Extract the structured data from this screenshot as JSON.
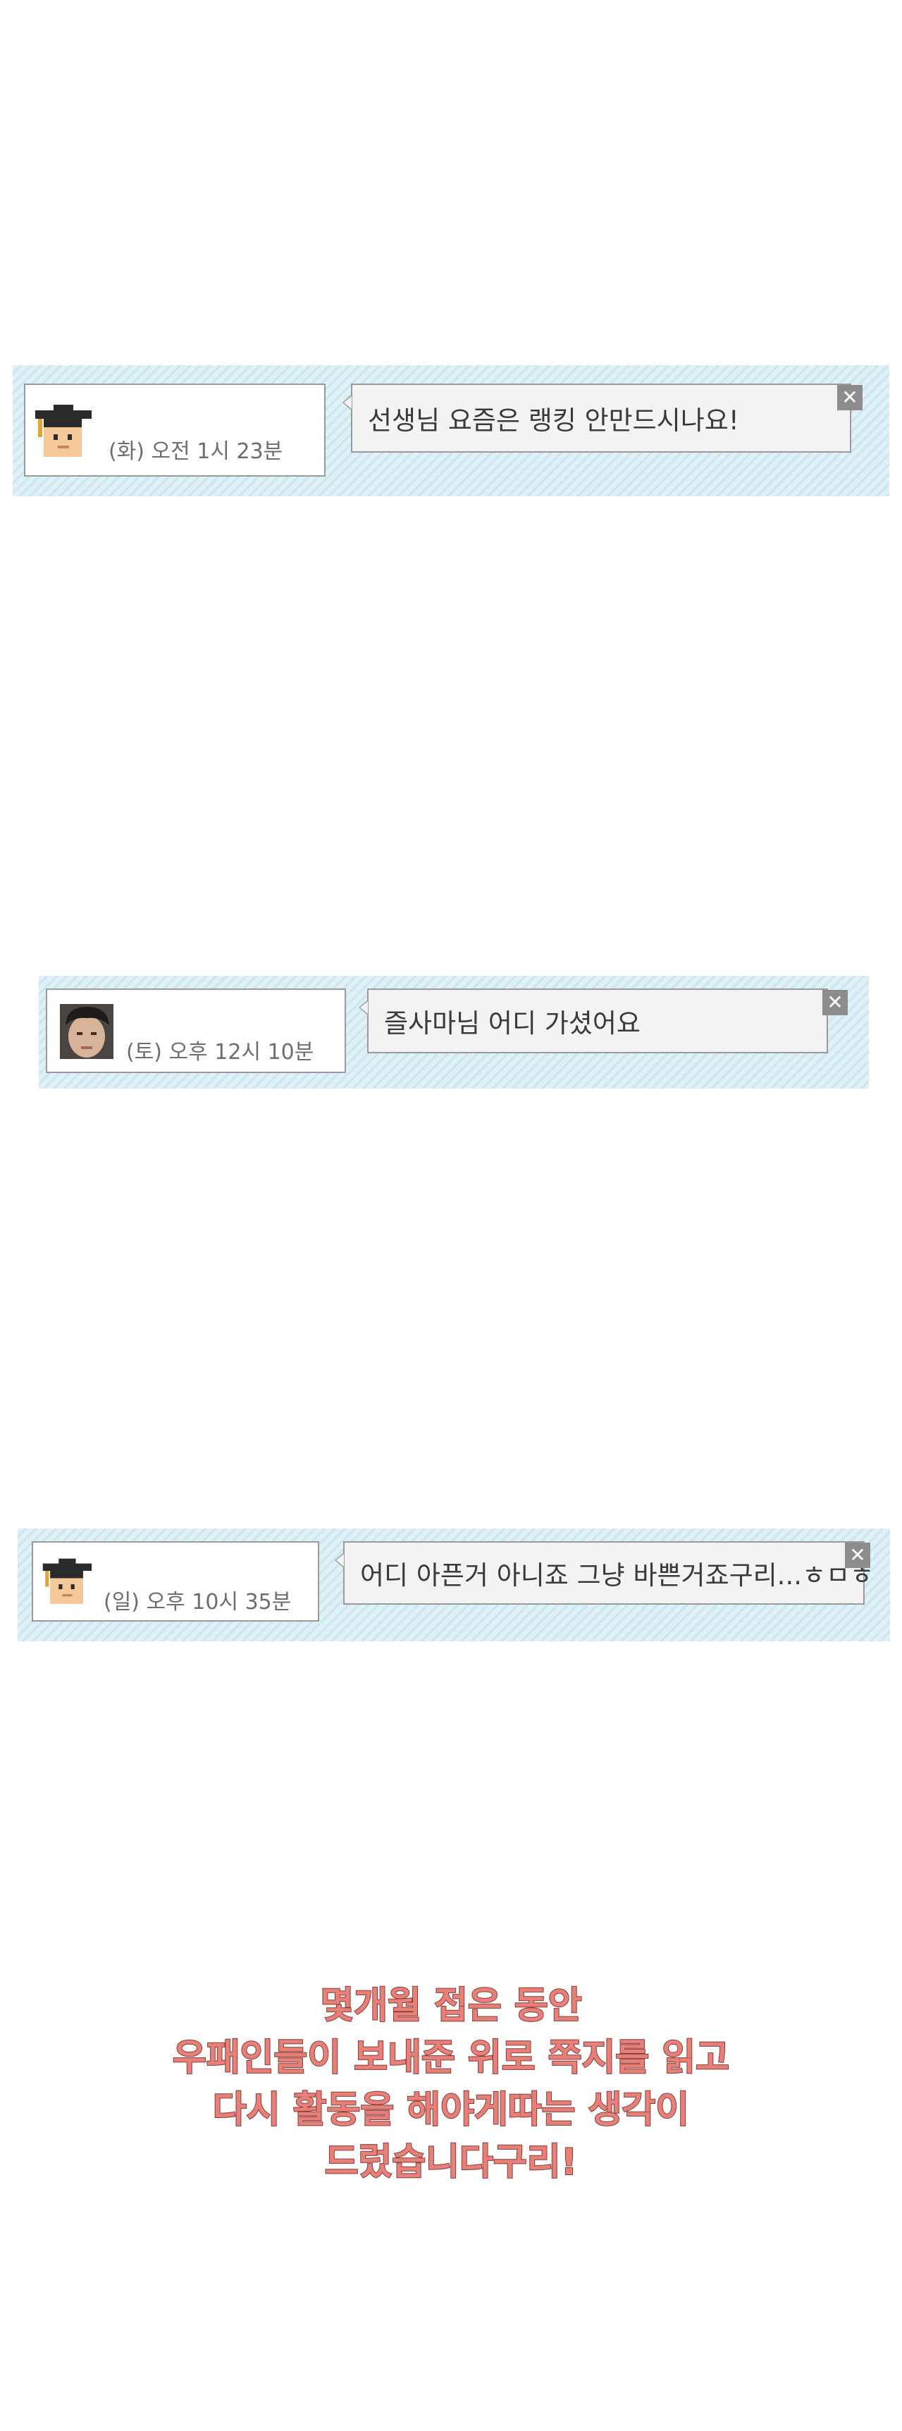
{
  "messages": [
    {
      "time": "(화) 오전 1시 23분",
      "text": "선생님 요즘은 랭킹 안만드시나요!",
      "avatar": "graduate-cap-icon",
      "close_label": "✕"
    },
    {
      "time": "(토) 오후 12시 10분",
      "text": "즐사마님 어디 가셨어요",
      "avatar": "user-photo",
      "close_label": "✕"
    },
    {
      "time": "(일) 오후 10시 35분",
      "text": "어디 아픈거 아니죠 그냥 바쁜거죠구리...ㅎㅁㅎ",
      "avatar": "graduate-cap-icon",
      "close_label": "✕"
    }
  ],
  "caption": {
    "lines": [
      "몇개월 접은 동안",
      "우패인들이 보내준 위로 쪽지를 읽고",
      "다시 활동을 해야게따는 생각이",
      "드렀습니다구리!"
    ]
  },
  "colors": {
    "card_stripe_light": "#dff0f7",
    "card_stripe_dark": "#cbe6f1",
    "border": "#9a9a9a",
    "caption_fill": "#e8807a",
    "caption_stroke": "#8a3a36"
  }
}
